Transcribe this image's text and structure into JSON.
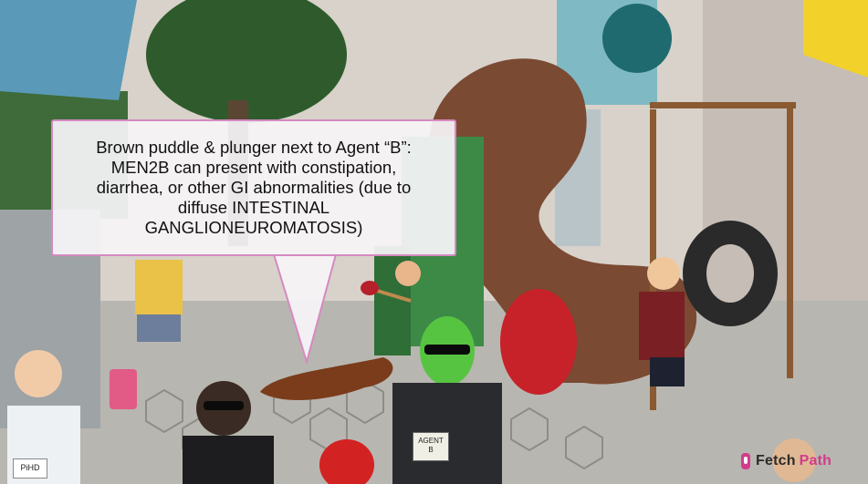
{
  "callout": {
    "text": "Brown puddle & plunger next to Agent “B”:\nMEN2B can present with constipation,\ndiarrhea, or other GI abnormalities (due to\ndiffuse INTESTINAL\nGANGLIONEUROMATOSIS)"
  },
  "labels": {
    "agent_badge": "AGENT\nB",
    "phd_badge": "PiHD"
  },
  "watermark": {
    "part1": "Fetch",
    "part2": "Path"
  },
  "colors": {
    "accent": "#d58ac0",
    "brand_pink": "#d23c8c",
    "tube": "#7a4a33",
    "alien_skin": "#57c441"
  }
}
